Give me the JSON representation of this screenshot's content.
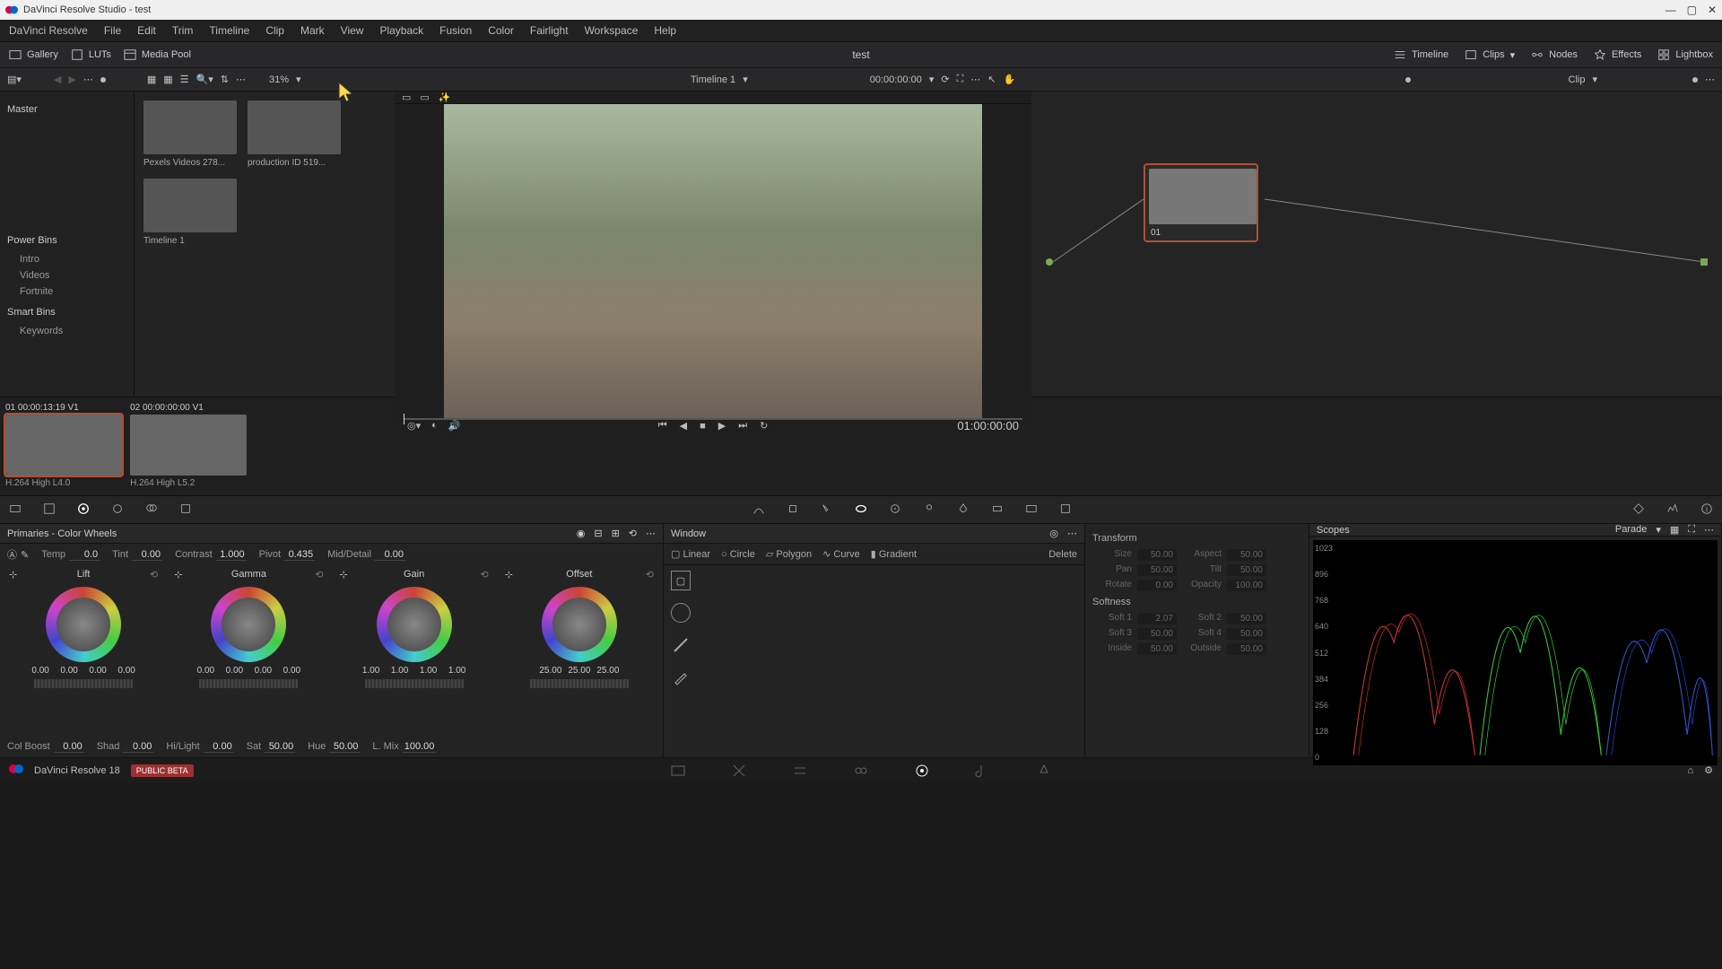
{
  "titlebar": {
    "text": "DaVinci Resolve Studio - test"
  },
  "menubar": [
    "DaVinci Resolve",
    "File",
    "Edit",
    "Trim",
    "Timeline",
    "Clip",
    "Mark",
    "View",
    "Playback",
    "Fusion",
    "Color",
    "Fairlight",
    "Workspace",
    "Help"
  ],
  "toolbar": {
    "gallery": "Gallery",
    "luts": "LUTs",
    "mediapool": "Media Pool",
    "project_title": "test",
    "timeline": "Timeline",
    "clips": "Clips",
    "nodes": "Nodes",
    "effects": "Effects",
    "lightbox": "Lightbox"
  },
  "subbar": {
    "zoom": "31%",
    "timeline_name": "Timeline 1",
    "timecode": "00:00:00:00",
    "clip_label": "Clip"
  },
  "sidebar": {
    "master": "Master",
    "powerbins": "Power Bins",
    "powerbins_items": [
      "Intro",
      "Videos",
      "Fortnite"
    ],
    "smartbins": "Smart Bins",
    "smartbins_items": [
      "Keywords"
    ]
  },
  "clips": [
    {
      "label": "Pexels Videos 278..."
    },
    {
      "label": "production ID 519..."
    },
    {
      "label": "Timeline 1"
    }
  ],
  "viewer": {
    "timecode": "01:00:00:00"
  },
  "node": {
    "label": "01"
  },
  "timeline_clips": [
    {
      "head": "01   00:00:13:19    V1",
      "foot": "H.264 High L4.0"
    },
    {
      "head": "02   00:00:00:00    V1",
      "foot": "H.264 High L5.2"
    }
  ],
  "wheels": {
    "title": "Primaries - Color Wheels",
    "params1": {
      "temp_l": "Temp",
      "temp_v": "0.0",
      "tint_l": "Tint",
      "tint_v": "0.00",
      "contrast_l": "Contrast",
      "contrast_v": "1.000",
      "pivot_l": "Pivot",
      "pivot_v": "0.435",
      "md_l": "Mid/Detail",
      "md_v": "0.00"
    },
    "groups": [
      {
        "name": "Lift",
        "nums": [
          "0.00",
          "0.00",
          "0.00",
          "0.00"
        ]
      },
      {
        "name": "Gamma",
        "nums": [
          "0.00",
          "0.00",
          "0.00",
          "0.00"
        ]
      },
      {
        "name": "Gain",
        "nums": [
          "1.00",
          "1.00",
          "1.00",
          "1.00"
        ]
      },
      {
        "name": "Offset",
        "nums": [
          "25.00",
          "25.00",
          "25.00"
        ]
      }
    ],
    "params2": {
      "cb_l": "Col Boost",
      "cb_v": "0.00",
      "shad_l": "Shad",
      "shad_v": "0.00",
      "hl_l": "Hi/Light",
      "hl_v": "0.00",
      "sat_l": "Sat",
      "sat_v": "50.00",
      "hue_l": "Hue",
      "hue_v": "50.00",
      "lmix_l": "L. Mix",
      "lmix_v": "100.00"
    }
  },
  "window": {
    "title": "Window",
    "tools": [
      "Linear",
      "Circle",
      "Polygon",
      "Curve",
      "Gradient",
      "Delete"
    ]
  },
  "transform": {
    "title": "Transform",
    "rows": [
      [
        "Size",
        "50.00",
        "Aspect",
        "50.00"
      ],
      [
        "Pan",
        "50.00",
        "Tilt",
        "50.00"
      ],
      [
        "Rotate",
        "0.00",
        "Opacity",
        "100.00"
      ]
    ],
    "soft_title": "Softness",
    "soft_rows": [
      [
        "Soft 1",
        "2.07",
        "Soft 2",
        "50.00"
      ],
      [
        "Soft 3",
        "50.00",
        "Soft 4",
        "50.00"
      ],
      [
        "Inside",
        "50.00",
        "Outside",
        "50.00"
      ]
    ]
  },
  "scopes": {
    "title": "Scopes",
    "mode": "Parade",
    "ticks": [
      "1023",
      "896",
      "768",
      "640",
      "512",
      "384",
      "256",
      "128",
      "0"
    ]
  },
  "bottombar": {
    "app": "DaVinci Resolve 18",
    "beta": "PUBLIC BETA"
  }
}
